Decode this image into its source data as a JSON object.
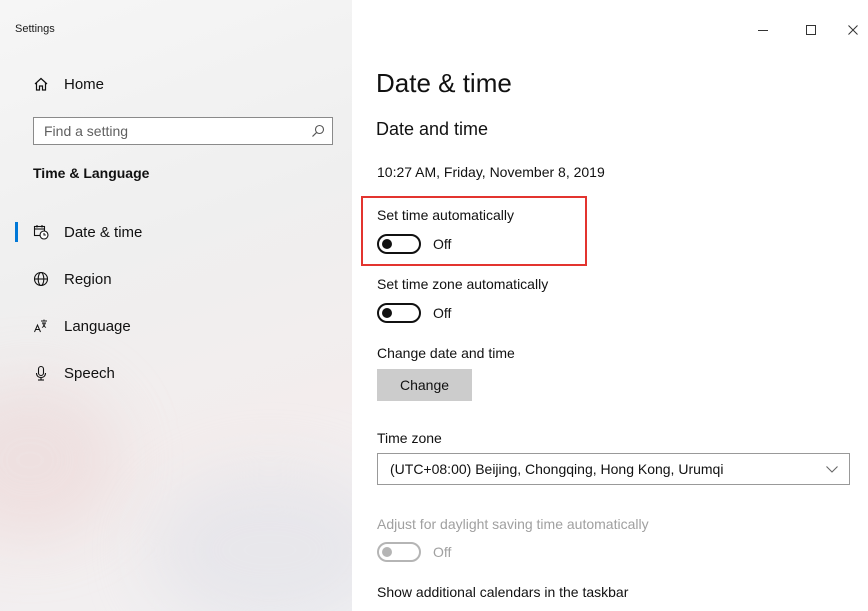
{
  "window": {
    "title": "Settings",
    "controls": [
      "minimize-icon",
      "maximize-icon",
      "close-icon"
    ]
  },
  "sidebar": {
    "home_label": "Home",
    "search": {
      "placeholder": "Find a setting",
      "value": ""
    },
    "section_title": "Time & Language",
    "items": [
      {
        "label": "Date & time",
        "icon": "calendar-clock-icon",
        "active": true
      },
      {
        "label": "Region",
        "icon": "globe-icon",
        "active": false
      },
      {
        "label": "Language",
        "icon": "language-icon",
        "active": false
      },
      {
        "label": "Speech",
        "icon": "microphone-icon",
        "active": false
      }
    ]
  },
  "main": {
    "page_title": "Date & time",
    "section_title": "Date and time",
    "current_datetime": "10:27 AM, Friday, November 8, 2019",
    "set_time_auto": {
      "label": "Set time automatically",
      "state": "Off"
    },
    "set_timezone_auto": {
      "label": "Set time zone automatically",
      "state": "Off"
    },
    "change_date_time": {
      "label": "Change date and time",
      "button": "Change"
    },
    "time_zone": {
      "label": "Time zone",
      "value": "(UTC+08:00) Beijing, Chongqing, Hong Kong, Urumqi"
    },
    "daylight_saving": {
      "label": "Adjust for daylight saving time automatically",
      "state": "Off",
      "disabled": true
    },
    "additional_calendars_label": "Show additional calendars in the taskbar"
  },
  "colors": {
    "accent": "#0078d7",
    "highlight": "#e3342f",
    "button_bg": "#cccccc",
    "disabled_text": "#a0a0a0"
  }
}
